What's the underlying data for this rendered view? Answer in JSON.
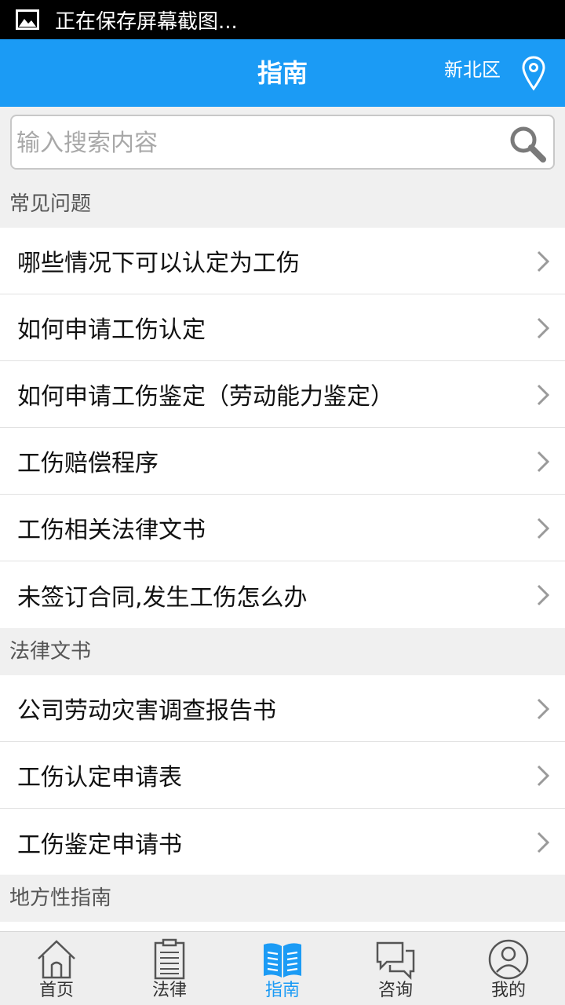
{
  "status_bar": {
    "text": "正在保存屏幕截图..."
  },
  "header": {
    "title": "指南",
    "location": "新北区"
  },
  "search": {
    "placeholder": "输入搜索内容"
  },
  "sections": [
    {
      "title": "常见问题",
      "items": [
        "哪些情况下可以认定为工伤",
        "如何申请工伤认定",
        "如何申请工伤鉴定（劳动能力鉴定）",
        "工伤赔偿程序",
        "工伤相关法律文书",
        "未签订合同,发生工伤怎么办"
      ]
    },
    {
      "title": "法律文书",
      "items": [
        "公司劳动灾害调查报告书",
        "工伤认定申请表",
        "工伤鉴定申请书"
      ]
    },
    {
      "title": "地方性指南",
      "items": []
    }
  ],
  "tabs": [
    {
      "label": "首页",
      "icon": "home-icon",
      "active": false
    },
    {
      "label": "法律",
      "icon": "document-icon",
      "active": false
    },
    {
      "label": "指南",
      "icon": "book-icon",
      "active": true
    },
    {
      "label": "咨询",
      "icon": "chat-icon",
      "active": false
    },
    {
      "label": "我的",
      "icon": "user-icon",
      "active": false
    }
  ],
  "colors": {
    "accent": "#1b9bf5",
    "status_bar": "#000000",
    "background": "#f0f0f0"
  }
}
